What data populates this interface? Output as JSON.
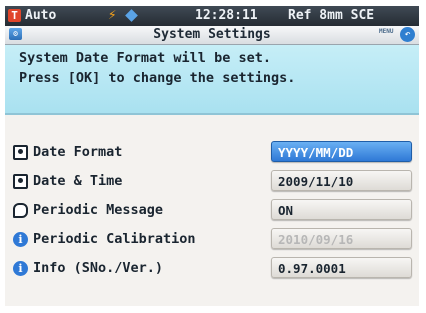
{
  "statusbar": {
    "mode": "Auto",
    "time": "12:28:11",
    "ref_info": "Ref 8mm SCE",
    "t_icon_label": "T",
    "accent_color": "#e0452a"
  },
  "titlebar": {
    "title": "System Settings",
    "menu_label": "MENU"
  },
  "message": {
    "line1": "System Date Format will be set.",
    "line2": "Press [OK] to change the settings."
  },
  "settings": [
    {
      "label": "Date Format",
      "value": "YYYY/MM/DD",
      "icon": "user-icon",
      "state": "selected"
    },
    {
      "label": "Date & Time",
      "value": "2009/11/10",
      "icon": "user-icon",
      "state": "normal"
    },
    {
      "label": "Periodic Message",
      "value": "ON",
      "icon": "message-icon",
      "state": "normal"
    },
    {
      "label": "Periodic Calibration",
      "value": "2010/09/16",
      "icon": "info-icon",
      "state": "disabled"
    },
    {
      "label": "Info (SNo./Ver.)",
      "value": "0.97.0001",
      "icon": "info-icon",
      "state": "normal"
    }
  ]
}
